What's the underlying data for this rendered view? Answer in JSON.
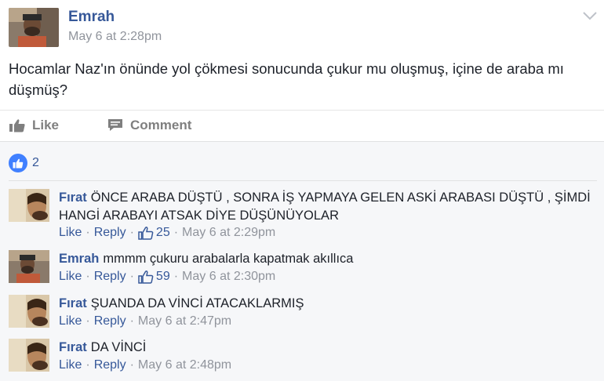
{
  "post": {
    "author": "Emrah",
    "timestamp": "May 6 at 2:28pm",
    "text": "Hocamlar Naz'ın önünde yol çökmesi sonucunda çukur mu oluşmuş, içine de araba mı düşmüş?",
    "avatar_icon": "profile-photo",
    "menu_icon": "chevron-down-icon"
  },
  "actions": {
    "like_label": "Like",
    "comment_label": "Comment"
  },
  "reactions": {
    "count": "2"
  },
  "comments": [
    {
      "author": "Fırat",
      "text": "ÖNCE ARABA DÜŞTÜ , SONRA İŞ YAPMAYA GELEN ASKİ ARABASI DÜŞTÜ , ŞİMDİ HANGİ ARABAYI ATSAK DİYE DÜŞÜNÜYOLAR",
      "like_label": "Like",
      "reply_label": "Reply",
      "likes": "25",
      "timestamp": "May 6 at 2:29pm"
    },
    {
      "author": "Emrah",
      "text": "mmmm çukuru arabalarla kapatmak akıllıca",
      "like_label": "Like",
      "reply_label": "Reply",
      "likes": "59",
      "timestamp": "May 6 at 2:30pm"
    },
    {
      "author": "Fırat",
      "text": "ŞUANDA DA VİNCİ ATACAKLARMIŞ",
      "like_label": "Like",
      "reply_label": "Reply",
      "likes": null,
      "timestamp": "May 6 at 2:47pm"
    },
    {
      "author": "Fırat",
      "text": "DA VİNCİ",
      "like_label": "Like",
      "reply_label": "Reply",
      "likes": null,
      "timestamp": "May 6 at 2:48pm"
    }
  ],
  "colors": {
    "link": "#365899",
    "meta": "#90949c",
    "text": "#1d2129",
    "like_badge": "#4080ff",
    "comments_bg": "#f6f7f9"
  }
}
